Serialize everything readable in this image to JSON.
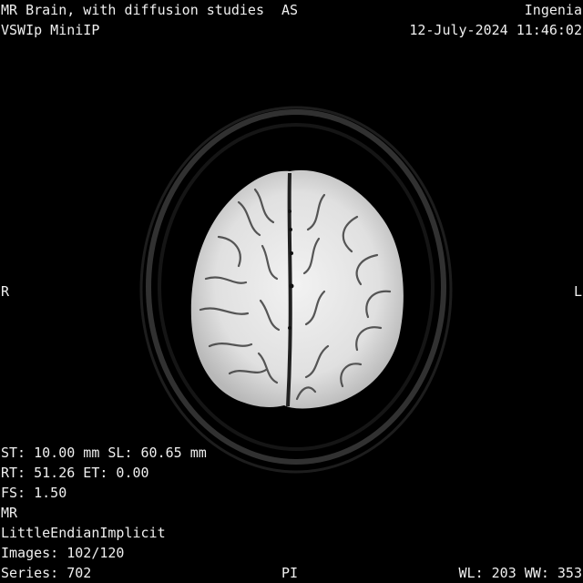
{
  "overlay": {
    "top_left": {
      "study_description": "MR Brain, with diffusion studies",
      "series_description": "VSWIp MiniIP"
    },
    "top_center": {
      "orientation_top": "AS"
    },
    "top_right": {
      "device": "Ingenia",
      "datetime": "12-July-2024 11:46:02"
    },
    "mid_left": {
      "orientation_left": "R"
    },
    "mid_right": {
      "orientation_right": "L"
    },
    "bottom_left": {
      "thickness_location": "ST: 10.00 mm SL: 60.65 mm",
      "timing": "RT: 51.26 ET: 0.00",
      "field_strength": "FS: 1.50",
      "modality": "MR",
      "transfer_syntax": "LittleEndianImplicit",
      "images": "Images: 102/120",
      "series": "Series: 702"
    },
    "bottom_center": {
      "orientation_bottom": "PI"
    },
    "bottom_right": {
      "window": "WL: 203 WW: 353"
    }
  },
  "image": {
    "modality": "MR",
    "background_color": "#000000",
    "brain_color": "#e6e6e6",
    "text_color": "#f0f0f0"
  }
}
